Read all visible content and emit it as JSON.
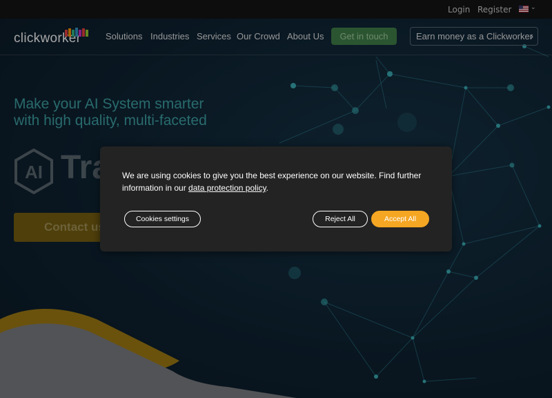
{
  "topbar": {
    "login": "Login",
    "register": "Register"
  },
  "nav": {
    "logo_text": "clickworker",
    "items": [
      "Solutions",
      "Industries",
      "Services",
      "Our Crowd",
      "About Us"
    ],
    "cta_touch": "Get in touch",
    "cta_earn": "Earn money as a Clickworker",
    "cta_earn_arrow": "›"
  },
  "hero": {
    "headline_line1": "Make your AI System smarter",
    "headline_line2": "with high quality, multi-faceted",
    "badge": "AI",
    "title": "Training Data",
    "contact_button": "Contact us"
  },
  "cookie_banner": {
    "message_before": "We are using cookies to give you the best experience on our website. Find further information in our ",
    "link_text": "data protection policy",
    "message_after": ".",
    "settings_button": "Cookies settings",
    "reject_button": "Reject All",
    "accept_button": "Accept All"
  },
  "colors": {
    "accent_orange": "#f5a623",
    "nav_green": "#43834a",
    "headline_teal": "#3fa5a8",
    "hero_bg": "#0f2434"
  }
}
